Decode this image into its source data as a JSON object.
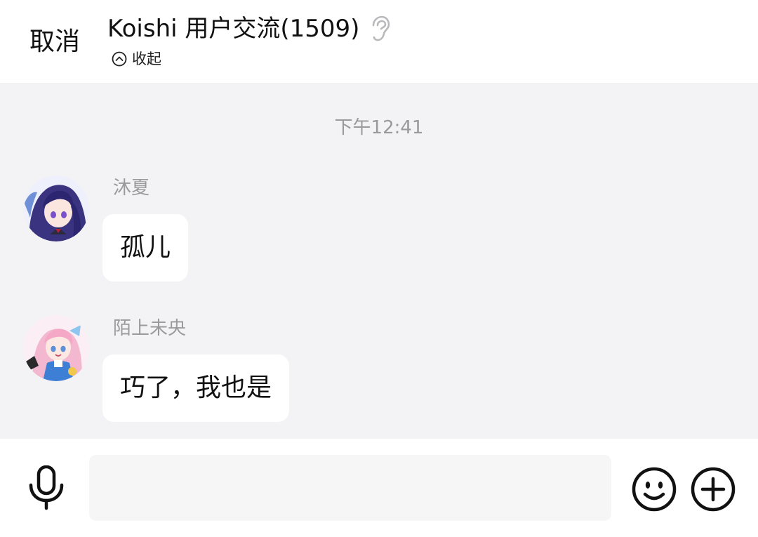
{
  "header": {
    "cancel_label": "取消",
    "title": "Koishi 用户交流(1509)",
    "collapse_label": "收起",
    "icons": {
      "mode": "ear-icon",
      "collapse": "chevron-up-circle-icon"
    }
  },
  "chat": {
    "timestamp": "下午12:41",
    "messages": [
      {
        "sender": "沐夏",
        "text": "孤儿",
        "avatar": "avatar-anime-purple-hair"
      },
      {
        "sender": "陌上未央",
        "text": "巧了，我也是",
        "avatar": "avatar-anime-pink-hair"
      }
    ]
  },
  "input_bar": {
    "message_value": "",
    "message_placeholder": "",
    "icons": {
      "voice": "microphone-icon",
      "emoji": "smiley-icon",
      "more": "plus-circle-icon"
    }
  },
  "colors": {
    "chat_background": "#f3f2f5",
    "bubble": "#ffffff",
    "secondary_text": "#9a9a9c",
    "primary_text": "#111111"
  }
}
